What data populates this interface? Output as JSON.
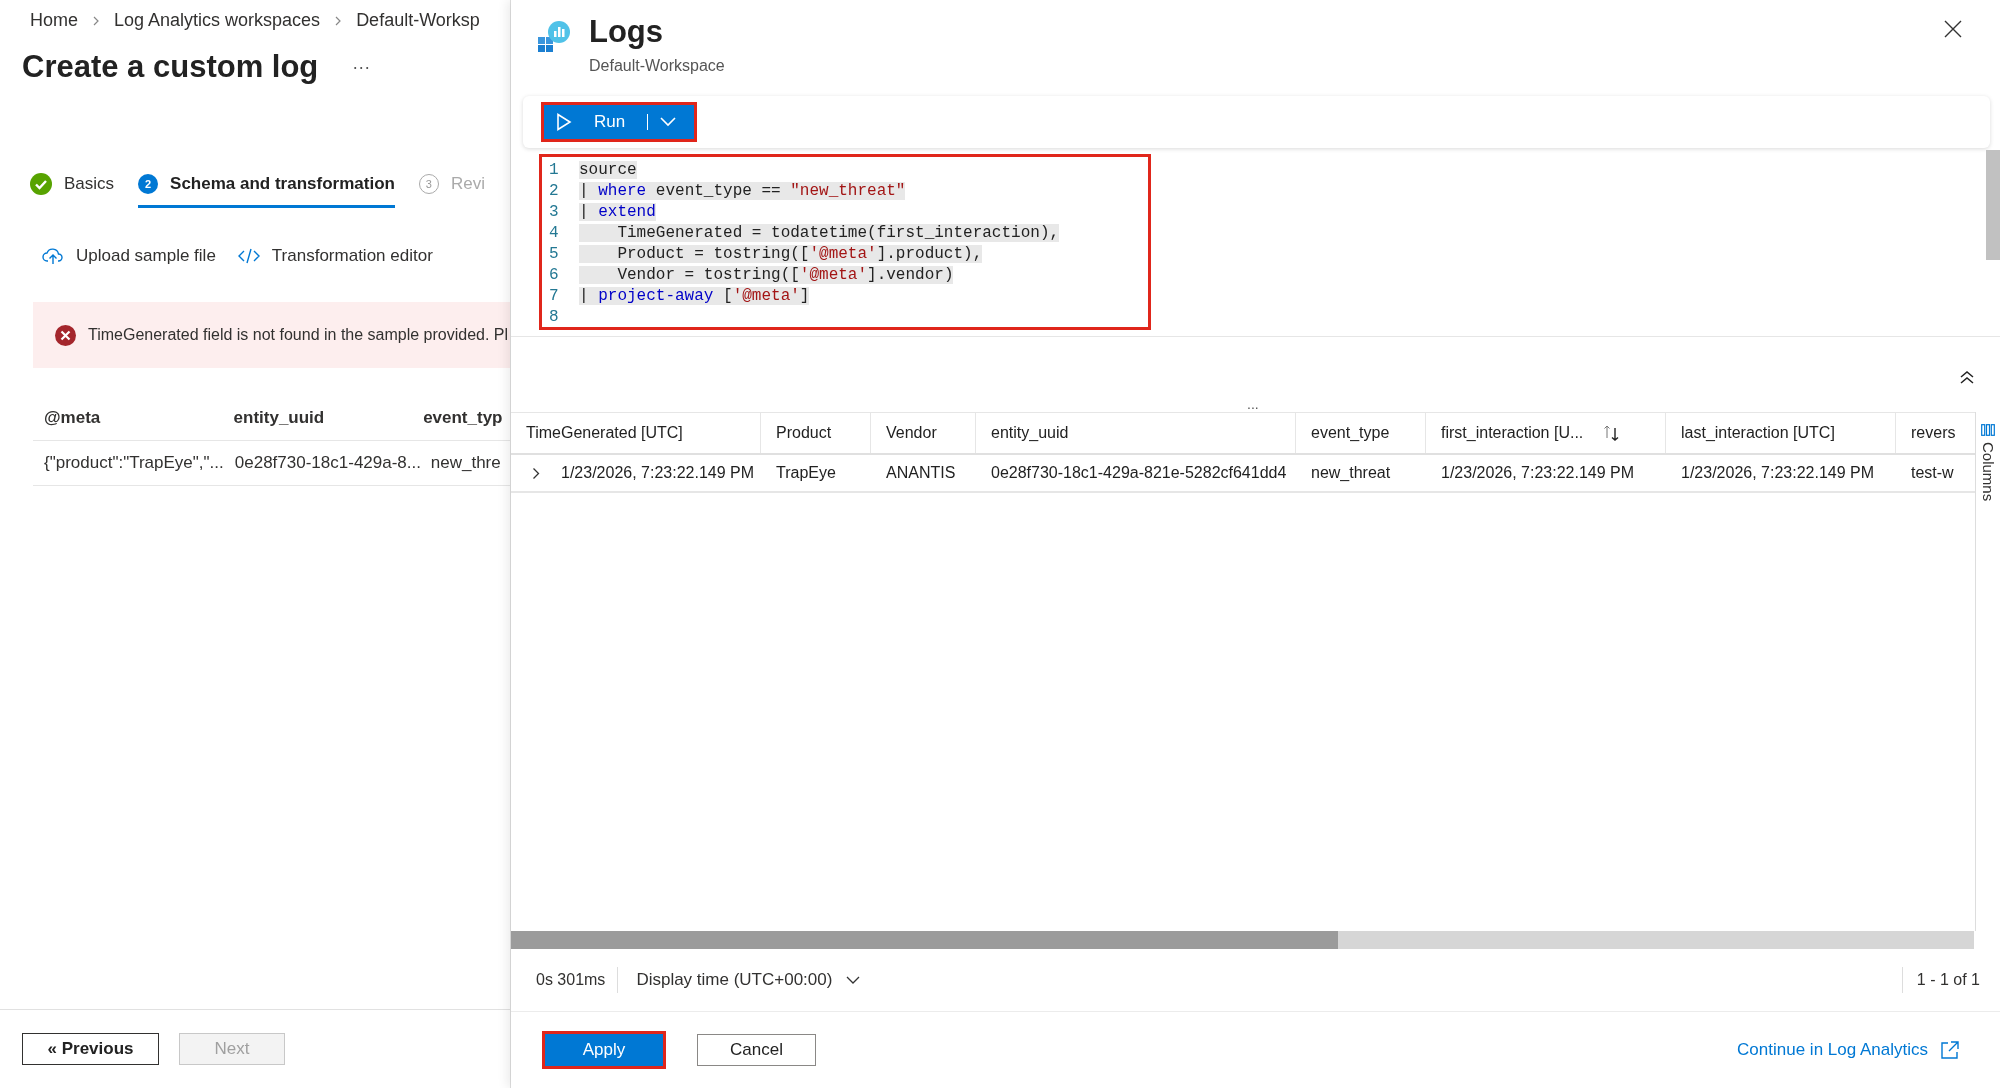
{
  "breadcrumb": [
    {
      "label": "Home"
    },
    {
      "label": "Log Analytics workspaces"
    },
    {
      "label": "Default-Worksp"
    }
  ],
  "page_title": "Create a custom log",
  "more": "···",
  "steps": [
    {
      "label": "Basics",
      "kind": "done",
      "selected": false
    },
    {
      "label": "Schema and transformation",
      "kind": "current",
      "number": "2",
      "selected": true
    },
    {
      "label": "Revi",
      "kind": "pending",
      "number": "3",
      "selected": false
    }
  ],
  "actions": [
    {
      "label": "Upload sample file",
      "kind": "upload"
    },
    {
      "label": "Transformation editor",
      "kind": "code"
    }
  ],
  "error": {
    "message": "TimeGenerated field is not found in the sample provided. Pl"
  },
  "sample_table": {
    "columns": [
      "@meta",
      "entity_uuid",
      "event_typ"
    ],
    "rows": [
      [
        "{\"product\":\"TrapEye\",\"...",
        "0e28f730-18c1-429a-8...",
        "new_thre"
      ]
    ]
  },
  "footer": {
    "previous": {
      "label": "« Previous",
      "disabled": false
    },
    "next": {
      "label": "Next",
      "disabled": true
    }
  },
  "logs": {
    "title": "Logs",
    "subtitle": "Default-Workspace",
    "run_button": {
      "label": "Run",
      "highlighted": true
    },
    "editor": {
      "highlighted": true,
      "lines": [
        {
          "number": "1",
          "tokens": [
            {
              "text": "source",
              "kind": "plain"
            }
          ]
        },
        {
          "number": "2",
          "tokens": [
            {
              "text": "| ",
              "kind": "plain"
            },
            {
              "text": "where",
              "kind": "keyword"
            },
            {
              "text": " event_type == ",
              "kind": "plain"
            },
            {
              "text": "\"new_threat\"",
              "kind": "string"
            }
          ]
        },
        {
          "number": "3",
          "tokens": [
            {
              "text": "| ",
              "kind": "plain"
            },
            {
              "text": "extend",
              "kind": "keyword"
            }
          ]
        },
        {
          "number": "4",
          "tokens": [
            {
              "text": "    TimeGenerated = todatetime(first_interaction),",
              "kind": "plain"
            }
          ]
        },
        {
          "number": "5",
          "tokens": [
            {
              "text": "    Product = tostring([",
              "kind": "plain"
            },
            {
              "text": "'@meta'",
              "kind": "string"
            },
            {
              "text": "].product),",
              "kind": "plain"
            }
          ]
        },
        {
          "number": "6",
          "tokens": [
            {
              "text": "    Vendor = tostring([",
              "kind": "plain"
            },
            {
              "text": "'@meta'",
              "kind": "string"
            },
            {
              "text": "].vendor)",
              "kind": "plain"
            }
          ]
        },
        {
          "number": "7",
          "tokens": [
            {
              "text": "| ",
              "kind": "plain"
            },
            {
              "text": "project-away",
              "kind": "keyword"
            },
            {
              "text": " [",
              "kind": "plain"
            },
            {
              "text": "'@meta'",
              "kind": "string"
            },
            {
              "text": "]",
              "kind": "plain"
            }
          ]
        },
        {
          "number": "8"
        }
      ]
    },
    "results": {
      "more": "...",
      "columns": [
        {
          "label": "TimeGenerated [UTC]",
          "sorted": false
        },
        {
          "label": "Product",
          "sorted": false
        },
        {
          "label": "Vendor",
          "sorted": false
        },
        {
          "label": "entity_uuid",
          "sorted": false
        },
        {
          "label": "event_type",
          "sorted": false
        },
        {
          "label": "first_interaction [U...",
          "sorted": true
        },
        {
          "label": "last_interaction [UTC]",
          "sorted": false
        },
        {
          "label": "revers",
          "sorted": false
        }
      ],
      "rows": [
        {
          "expanded": false,
          "cells": [
            "1/23/2026, 7:23:22.149 PM",
            "TrapEye",
            "ANANTIS",
            "0e28f730-18c1-429a-821e-5282cf641dd4",
            "new_threat",
            "1/23/2026, 7:23:22.149 PM",
            "1/23/2026, 7:23:22.149 PM",
            "test-w"
          ]
        }
      ],
      "columns_panel": "Columns"
    },
    "status": {
      "duration": "0s 301ms",
      "display_time": "Display time (UTC+00:00)",
      "paging": "1 - 1 of 1"
    },
    "apply_button": {
      "label": "Apply",
      "highlighted": true
    },
    "cancel_button": {
      "label": "Cancel"
    },
    "continue_link": "Continue in Log Analytics"
  }
}
